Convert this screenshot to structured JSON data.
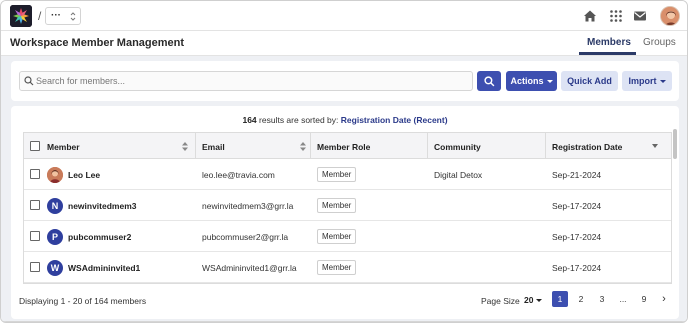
{
  "topbar": {
    "separator": "/",
    "workspace_select": "···"
  },
  "header": {
    "title": "Workspace Member Management",
    "tabs": [
      {
        "label": "Members",
        "active": true
      },
      {
        "label": "Groups",
        "active": false
      }
    ]
  },
  "toolbar": {
    "search_placeholder": "Search for members...",
    "actions_label": "Actions",
    "quick_add_label": "Quick Add",
    "import_label": "Import"
  },
  "results": {
    "count": "164",
    "sorted_text": "results are sorted by:",
    "sort_key": "Registration Date (Recent)"
  },
  "table": {
    "columns": [
      "Member",
      "Email",
      "Member Role",
      "Community",
      "Registration Date"
    ],
    "rows": [
      {
        "initial": "",
        "name": "Leo Lee",
        "email": "leo.lee@travia.com",
        "role": "Member",
        "community": "Digital Detox",
        "date": "Sep-21-2024"
      },
      {
        "initial": "N",
        "name": "newinvitedmem3",
        "email": "newinvitedmem3@grr.la",
        "role": "Member",
        "community": "",
        "date": "Sep-17-2024"
      },
      {
        "initial": "P",
        "name": "pubcommuser2",
        "email": "pubcommuser2@grr.la",
        "role": "Member",
        "community": "",
        "date": "Sep-17-2024"
      },
      {
        "initial": "W",
        "name": "WSAdmininvited1",
        "email": "WSAdmininvited1@grr.la",
        "role": "Member",
        "community": "",
        "date": "Sep-17-2024"
      }
    ]
  },
  "footer": {
    "displaying": "Displaying 1 - 20 of 164 members",
    "page_size_label": "Page Size",
    "page_size_value": "20",
    "pages": [
      "1",
      "2",
      "3",
      "...",
      "9"
    ],
    "current_page": "1",
    "next_label": "›"
  },
  "colors": {
    "accent": "#3d4fb0",
    "accent_light": "#dde3f4",
    "tab_active": "#2b3a67",
    "page_bg": "#eef0f4"
  }
}
